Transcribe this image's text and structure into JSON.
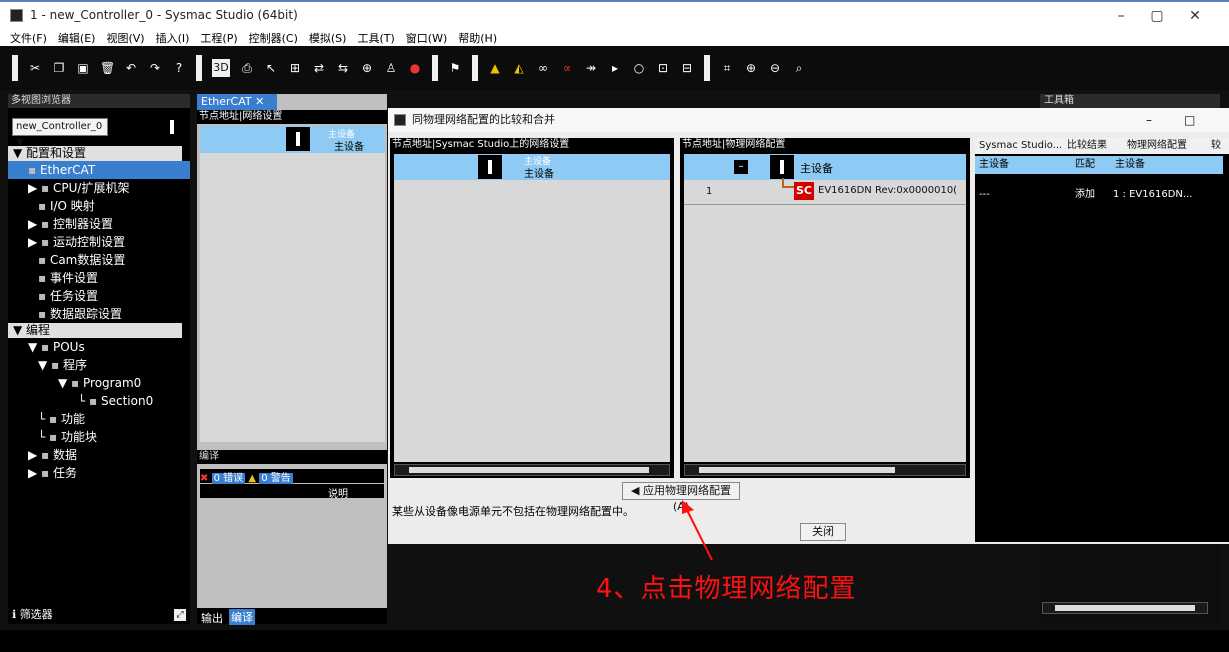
{
  "window": {
    "title": "1 - new_Controller_0 - Sysmac Studio (64bit)",
    "minimize": "–",
    "restore": "▢",
    "close": "✕"
  },
  "menu": [
    "文件(F)",
    "编辑(E)",
    "视图(V)",
    "插入(I)",
    "工程(P)",
    "控制器(C)",
    "模拟(S)",
    "工具(T)",
    "窗口(W)",
    "帮助(H)"
  ],
  "left_panel": {
    "header": "多视图浏览器",
    "controller": "new_Controller_0",
    "config_section": "配置和设置",
    "config_items": [
      {
        "label": "EtherCAT",
        "indent": 20,
        "prefix": "",
        "selected": true
      },
      {
        "label": "CPU/扩展机架",
        "indent": 20,
        "prefix": "▶",
        "selected": false
      },
      {
        "label": "I/O 映射",
        "indent": 30,
        "prefix": "",
        "selected": false
      },
      {
        "label": "控制器设置",
        "indent": 20,
        "prefix": "▶",
        "selected": false
      },
      {
        "label": "运动控制设置",
        "indent": 20,
        "prefix": "▶",
        "selected": false
      },
      {
        "label": "Cam数据设置",
        "indent": 30,
        "prefix": "",
        "selected": false
      },
      {
        "label": "事件设置",
        "indent": 30,
        "prefix": "",
        "selected": false
      },
      {
        "label": "任务设置",
        "indent": 30,
        "prefix": "",
        "selected": false
      },
      {
        "label": "数据跟踪设置",
        "indent": 30,
        "prefix": "",
        "selected": false
      }
    ],
    "program_section": "编程",
    "program_items": [
      {
        "label": "POUs",
        "indent": 20,
        "prefix": "▼"
      },
      {
        "label": "程序",
        "indent": 30,
        "prefix": "▼"
      },
      {
        "label": "Program0",
        "indent": 50,
        "prefix": "▼"
      },
      {
        "label": "Section0",
        "indent": 70,
        "prefix": "└"
      },
      {
        "label": "功能",
        "indent": 30,
        "prefix": "└"
      },
      {
        "label": "功能块",
        "indent": 30,
        "prefix": "└"
      },
      {
        "label": "数据",
        "indent": 20,
        "prefix": "▶"
      },
      {
        "label": "任务",
        "indent": 20,
        "prefix": "▶"
      }
    ],
    "filter": "筛选器"
  },
  "center_panel": {
    "tab": "EtherCAT",
    "header": "节点地址|网络设置",
    "master_label_top": "主设备",
    "master_label_bottom": "主设备",
    "compile_header": "编译",
    "errors": "0 错误",
    "warnings": "0 警告",
    "desc_col": "说明",
    "bottom_tab_output": "输出",
    "bottom_tab_compile": "编译"
  },
  "dialog": {
    "title": "同物理网络配置的比较和合并",
    "left_header": "节点地址|Sysmac Studio上的网络设置",
    "left_master_top": "主设备",
    "left_master_bottom": "主设备",
    "mid_header": "节点地址|物理网络配置",
    "mid_master": "主设备",
    "mid_node_number": "1",
    "mid_node_icon": "SC",
    "mid_node_label": "EV1616DN Rev:0x0000010(",
    "right_headers": [
      "Sysmac Studio...",
      "比较结果",
      "物理网络配置",
      "较"
    ],
    "right_row1": [
      "主设备",
      "匹配",
      "主设备"
    ],
    "right_row2": [
      "---",
      "添加",
      "1 : EV1616DN..."
    ],
    "apply_button": "◀ 应用物理网络配置(A)",
    "note": "某些从设备像电源单元不包括在物理网络配置中。",
    "close_button": "关闭",
    "minimize": "–",
    "maximize": "□"
  },
  "toolbox": {
    "header": "工具箱"
  },
  "annotation": "4、点击物理网络配置",
  "colors": {
    "selection": "#8ecaf3",
    "tab_blue": "#3a7fcf",
    "annotation": "#ff1111"
  }
}
